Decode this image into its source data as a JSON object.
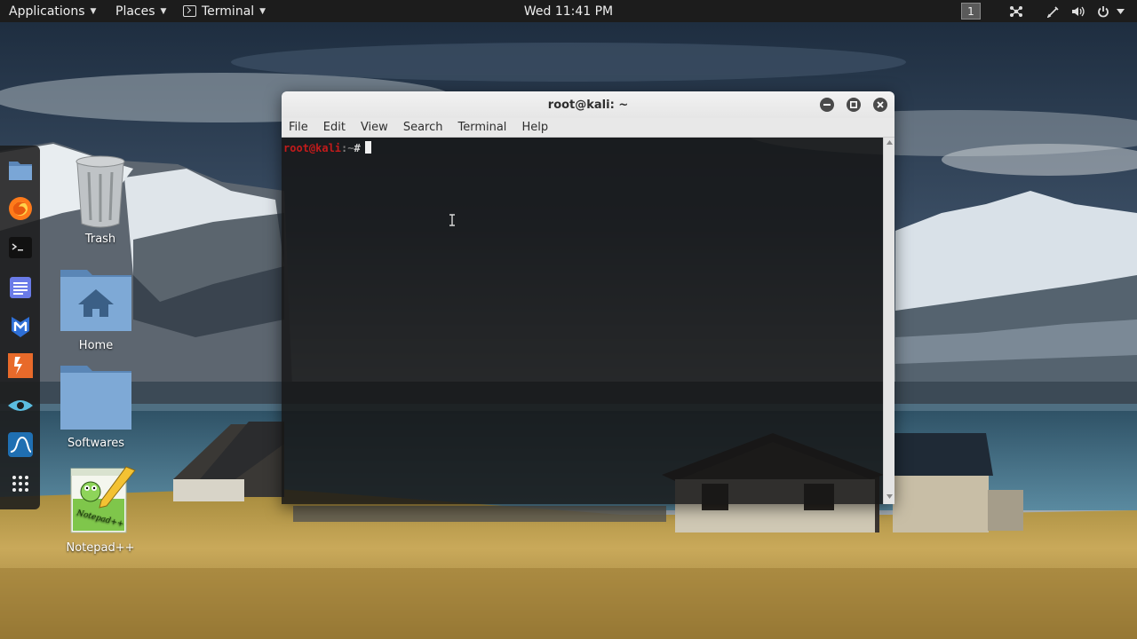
{
  "topbar": {
    "applications": "Applications",
    "places": "Places",
    "terminal": "Terminal",
    "clock": "Wed 11:41 PM",
    "workspace": "1"
  },
  "dock": {
    "items": [
      "files-icon",
      "firefox-icon",
      "terminal-icon",
      "text-editor-icon",
      "metasploit-icon",
      "burpsuite-icon",
      "eye-icon",
      "wireshark-icon",
      "show-apps-icon"
    ]
  },
  "desktop": {
    "icons": [
      {
        "label": "Trash"
      },
      {
        "label": "Home"
      },
      {
        "label": "Softwares"
      },
      {
        "label": "Notepad++"
      }
    ],
    "notepad_logo_text": "Notepad++"
  },
  "terminal_window": {
    "title": "root@kali: ~",
    "menu": [
      "File",
      "Edit",
      "View",
      "Search",
      "Terminal",
      "Help"
    ],
    "prompt_user": "root@kali",
    "prompt_path": ":~",
    "prompt_symbol": "#"
  },
  "colors": {
    "prompt_user": "#c21b1b",
    "topbar_bg": "#1c1c1c",
    "window_title_bg": "#f2f2f2",
    "terminal_bg": "#161616"
  }
}
